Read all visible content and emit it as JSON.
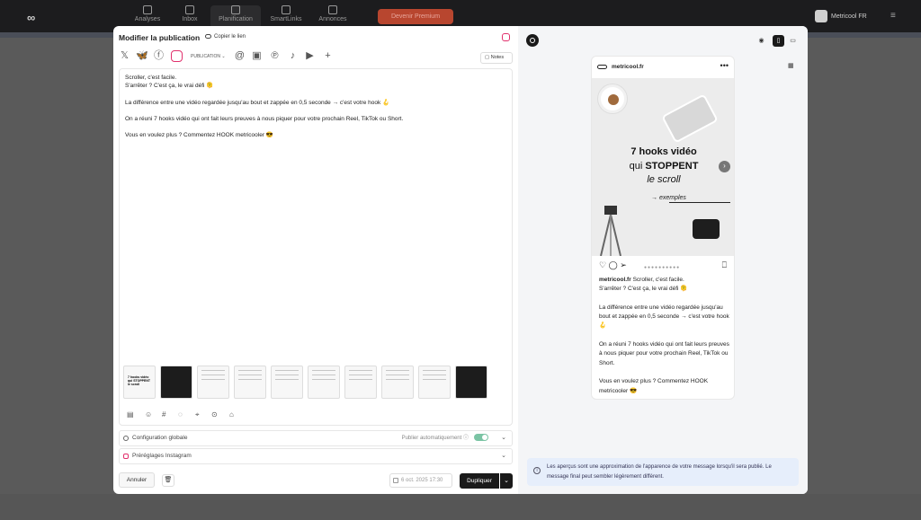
{
  "nav": {
    "logo": "∞",
    "items": [
      {
        "label": "Analyses"
      },
      {
        "label": "Inbox"
      },
      {
        "label": "Planification"
      },
      {
        "label": "SmartLinks"
      },
      {
        "label": "Annonces"
      }
    ],
    "cta": "Devenir Premium",
    "brand": "Metricool FR",
    "menu": "≡"
  },
  "modal": {
    "title": "Modifier la publication",
    "copy_link": "Copier le lien",
    "publication_select": "PUBLICATION",
    "notes": "Notes",
    "post_text": "Scroller, c'est facile.\nS'arrêter ? C'est ça, le vrai défi 🫠\n\nLa différence entre une vidéo regardée jusqu'au bout et zappée en 0,5 seconde → c'est votre hook 🪝\n\nOn a réuni 7 hooks vidéo qui ont fait leurs preuves à nous piquer pour votre prochain Reel, TikTok ou Short.\n\nVous en voulez plus ? Commentez HOOK metricooler 😎",
    "config_global": "Configuration globale",
    "auto_publish": "Publier automatiquement",
    "instagram_presets": "Préréglages Instagram",
    "cancel": "Annuler",
    "date": "6 oct. 2025 17:30",
    "duplicate": "Dupliquer",
    "thumb_first_text": "7 hooks vidéo qui STOPPENT le scroll"
  },
  "preview": {
    "account": "metricool.fr",
    "more": "•••",
    "img_title1": "7 hooks vidéo",
    "img_title2a": "qui ",
    "img_title2b": "STOPPENT",
    "img_title3": "le scroll",
    "img_exemples": "exemples",
    "caption_user": "metricool.fr",
    "caption_text": " Scroller, c'est facile.\nS'arrêter ? C'est ça, le vrai défi 🫠\n\nLa différence entre une vidéo regardée jusqu'au bout et zappée en 0,5 seconde → c'est votre hook 🪝\n\nOn a réuni 7 hooks vidéo qui ont fait leurs preuves à nous piquer pour votre prochain Reel, TikTok ou Short.\n\nVous en voulez plus ? Commentez HOOK metricooler 😎",
    "info": "Les aperçus sont une approximation de l'apparence de votre message lorsqu'il sera publié. Le message final peut sembler légèrement différent."
  },
  "colors": {
    "instagram": "#e1306c",
    "toggle_on": "#7bc4a4",
    "primary_button": "#1a1a1a",
    "info_bg": "#e6eefb"
  },
  "icons": [
    "x-icon",
    "bluesky-icon",
    "facebook-icon",
    "instagram-icon",
    "threads-icon",
    "linkedin-icon",
    "pinterest-icon",
    "tiktok-icon",
    "youtube-icon",
    "add-network-icon"
  ]
}
